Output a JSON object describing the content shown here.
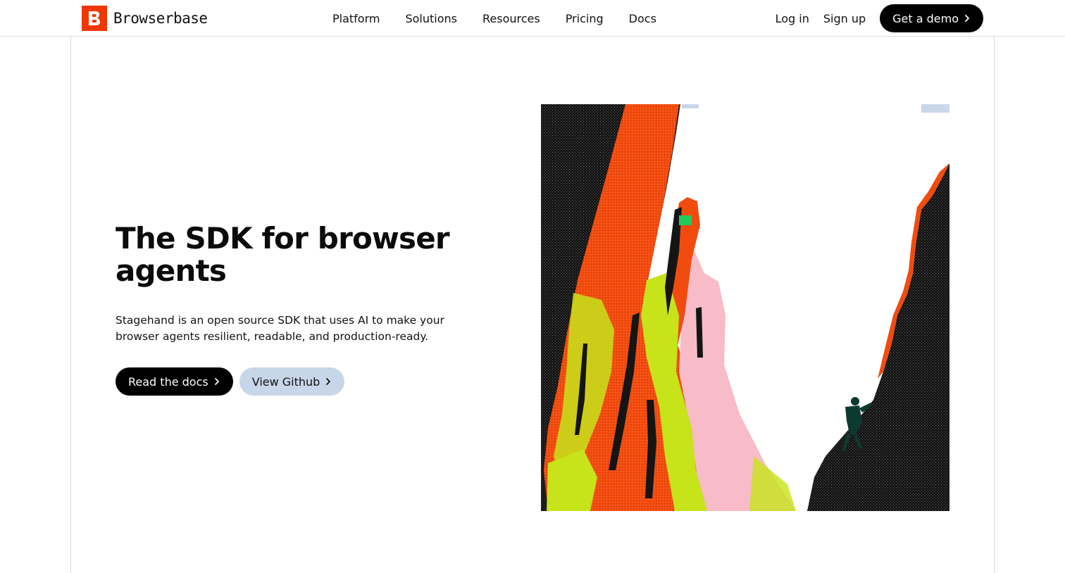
{
  "brand": {
    "name": "Browserbase",
    "logo_letter": "B",
    "accent_color": "#f03603"
  },
  "nav": {
    "items": [
      {
        "label": "Platform"
      },
      {
        "label": "Solutions"
      },
      {
        "label": "Resources"
      },
      {
        "label": "Pricing"
      },
      {
        "label": "Docs"
      }
    ]
  },
  "auth": {
    "login_label": "Log in",
    "signup_label": "Sign up",
    "demo_label": "Get a demo"
  },
  "hero": {
    "title": "The SDK for browser agents",
    "description": "Stagehand is an open source SDK that uses AI to make your browser agents resilient, readable, and production-ready.",
    "primary_button": "Read the docs",
    "secondary_button": "View Github",
    "illustration_icon": "rock-climber-illustration",
    "palette": {
      "orange": "#f24b0f",
      "lime": "#c7e31a",
      "pink": "#f7bcc8",
      "rock": "#151515",
      "sky": "#ffffff",
      "green": "#21c95a",
      "sky_tint": "#c9d7ea"
    }
  }
}
